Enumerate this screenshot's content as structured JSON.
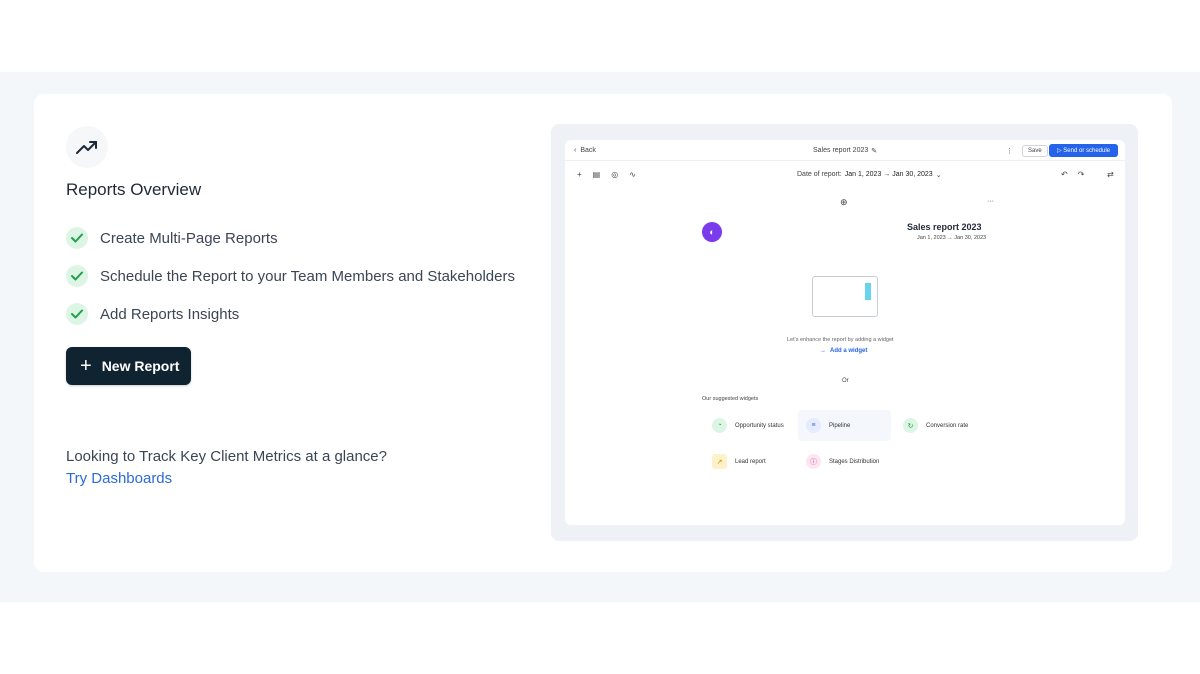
{
  "overview": {
    "title": "Reports Overview",
    "features": [
      "Create Multi-Page Reports",
      "Schedule the Report to your Team Members and Stakeholders",
      "Add Reports Insights"
    ],
    "new_button": "New Report",
    "question": "Looking to Track Key Client Metrics at a glance?",
    "dashboards_link": "Try Dashboards"
  },
  "preview": {
    "back": "Back",
    "doc_title": "Sales report 2023",
    "save": "Save",
    "send": "Send or schedule",
    "date_label": "Date of report:",
    "date_range": "Jan 1, 2023 → Jan 30, 2023",
    "report_title": "Sales report 2023",
    "report_dates": "Jan 1, 2023 → Jan 30, 2023",
    "empty_text": "Let's enhance the report by adding a widget",
    "add_widget": "Add a widget",
    "or": "Or",
    "suggested": "Our suggested widgets",
    "widgets": [
      "Opportunity status",
      "Pipeline",
      "Conversion rate",
      "Lead report",
      "Stages Distribution"
    ]
  },
  "colors": {
    "accent": "#2563eb",
    "button_dark": "#0f2430",
    "link": "#2c6bd8",
    "check_bg": "#dcf5e4",
    "check": "#22a04b"
  }
}
